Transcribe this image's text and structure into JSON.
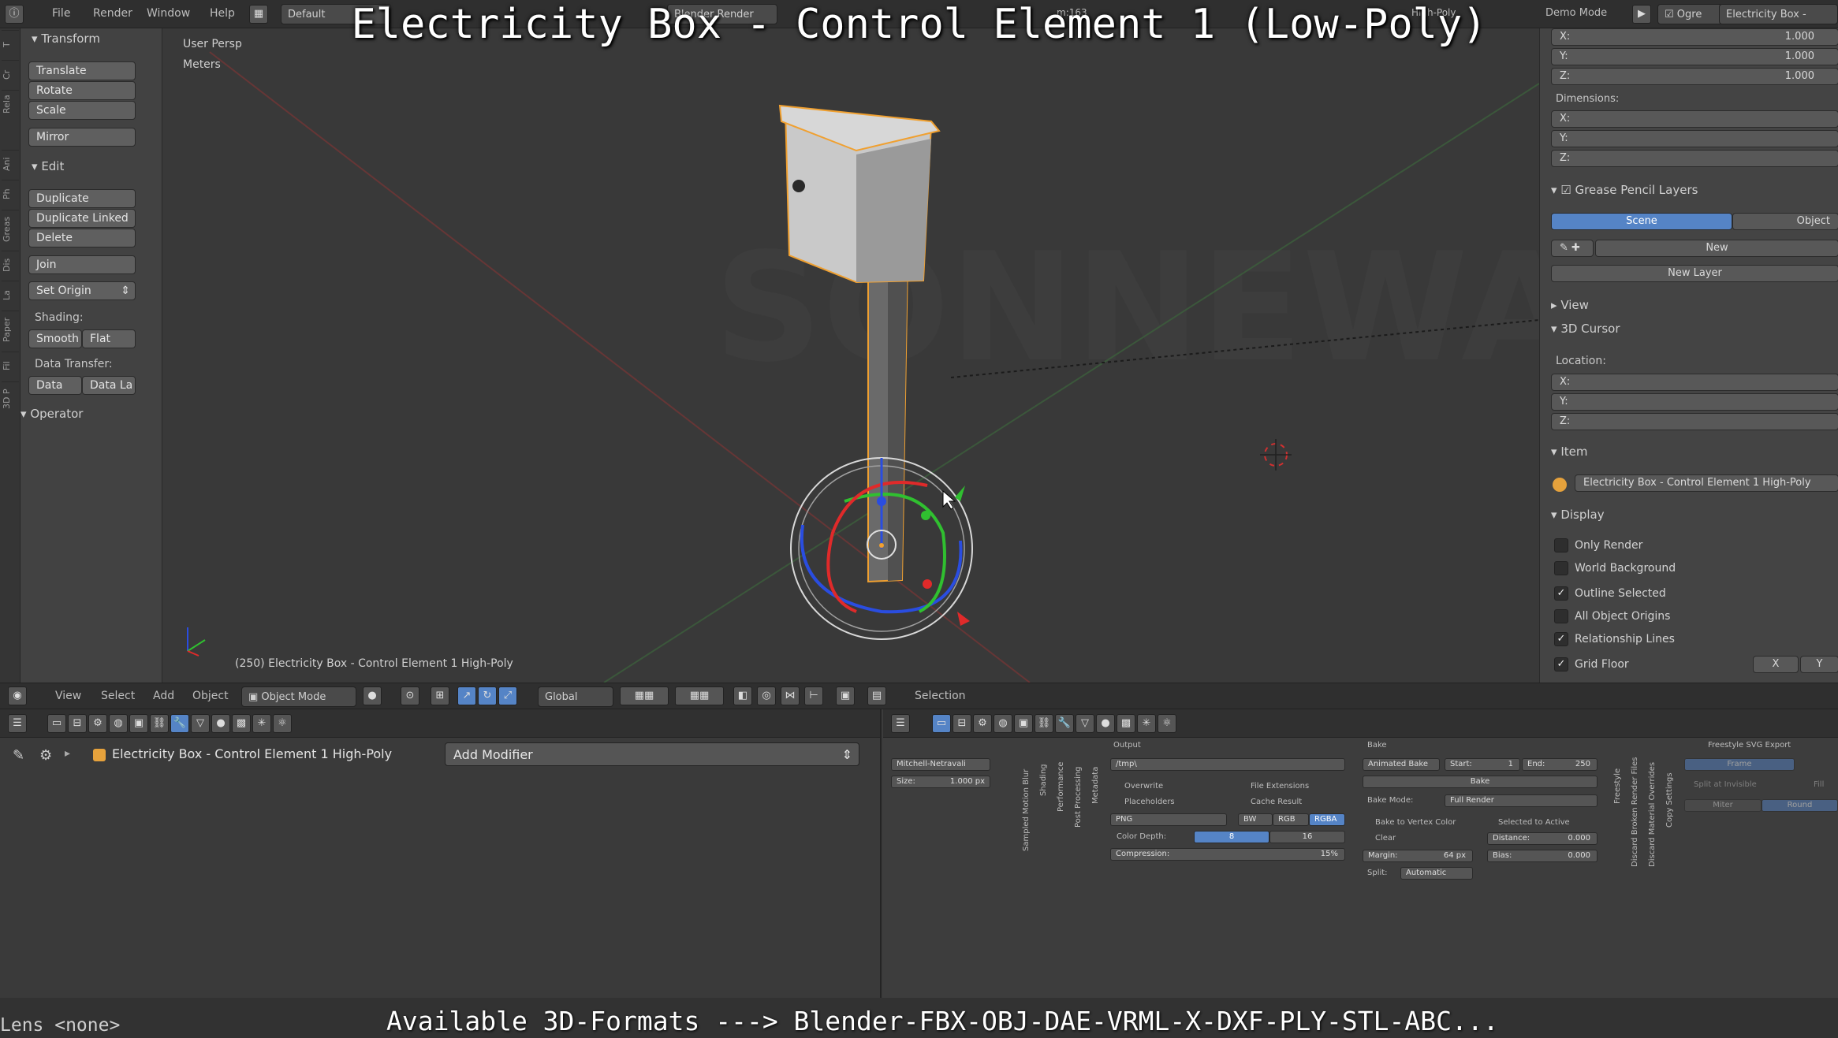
{
  "title_overlay": "Electricity Box - Control Element 1 (Low-Poly)",
  "topbar": {
    "menus": [
      "File",
      "Render",
      "Window",
      "Help"
    ],
    "layout": "Default",
    "engine": "Blender Render",
    "demo_mode": "Demo Mode",
    "ogre": "Ogre",
    "scene_name": "Electricity Box -",
    "stats_fragment": "m:163",
    "object_fragment": "Electricity Box -",
    "poly_fragment": "High-Poly"
  },
  "side_tabs": [
    "T",
    "Cr",
    "Rela",
    "Ani",
    "Ph",
    "Greas",
    "Dis",
    "La",
    "Paper",
    "Fil",
    "3D P"
  ],
  "toolshelf": {
    "transform_header": "Transform",
    "translate": "Translate",
    "rotate": "Rotate",
    "scale": "Scale",
    "mirror": "Mirror",
    "edit_header": "Edit",
    "duplicate": "Duplicate",
    "duplicate_linked": "Duplicate Linked",
    "delete": "Delete",
    "join": "Join",
    "set_origin": "Set Origin",
    "shading_label": "Shading:",
    "smooth": "Smooth",
    "flat": "Flat",
    "data_transfer_label": "Data Transfer:",
    "data": "Data",
    "data_la": "Data La",
    "operator_header": "Operator"
  },
  "viewport": {
    "view_name": "User Persp",
    "units": "Meters",
    "status": "(250) Electricity Box - Control Element 1 High-Poly",
    "watermark": "SONNEWARE"
  },
  "npanel": {
    "scale_x_label": "X:",
    "scale_x": "1.000",
    "scale_y_label": "Y:",
    "scale_y": "1.000",
    "scale_z_label": "Z:",
    "scale_z": "1.000",
    "dimensions_label": "Dimensions:",
    "dim_x": "X:",
    "dim_y": "Y:",
    "dim_z": "Z:",
    "grease_header": "Grease Pencil Layers",
    "tab_scene": "Scene",
    "tab_object": "Object",
    "new_btn": "New",
    "new_layer_btn": "New Layer",
    "view_header": "View",
    "cursor_header": "3D Cursor",
    "location_label": "Location:",
    "loc_x": "X:",
    "loc_y": "Y:",
    "loc_z": "Z:",
    "item_header": "Item",
    "item_name": "Electricity Box - Control Element 1 High-Poly",
    "display_header": "Display",
    "only_render": "Only Render",
    "world_background": "World Background",
    "outline_selected": "Outline Selected",
    "all_object_origins": "All Object Origins",
    "relationship_lines": "Relationship Lines",
    "grid_floor": "Grid Floor",
    "axis_x": "X",
    "axis_y": "Y"
  },
  "vp_header": {
    "menu_view": "View",
    "menu_select": "Select",
    "menu_add": "Add",
    "menu_object": "Object",
    "mode": "Object Mode",
    "orientation": "Global",
    "selection": "Selection"
  },
  "modifier_panel": {
    "object_name": "Electricity Box - Control Element 1 High-Poly",
    "add_modifier": "Add Modifier"
  },
  "render_panel": {
    "filter": "Mitchell-Netravali",
    "size_label": "Size:",
    "size_value": "1.000 px",
    "vert_labels": [
      "Sampled Motion Blur",
      "Shading",
      "Performance",
      "Post Processing",
      "Metadata"
    ],
    "output_header": "Output",
    "output_path": "/tmp\\",
    "overwrite": "Overwrite",
    "file_extensions": "File Extensions",
    "placeholders": "Placeholders",
    "cache_result": "Cache Result",
    "format": "PNG",
    "bw": "BW",
    "rgb": "RGB",
    "rgba": "RGBA",
    "color_depth_label": "Color Depth:",
    "depth_8": "8",
    "depth_16": "16",
    "compression_label": "Compression:",
    "compression_value": "15%",
    "bake_header": "Bake",
    "animated_bake": "Animated Bake",
    "start_label": "Start:",
    "start_value": "1",
    "end_label": "End:",
    "end_value": "250",
    "bake_btn": "Bake",
    "bake_mode_label": "Bake Mode:",
    "bake_mode": "Full Render",
    "bake_vertex_color": "Bake to Vertex Color",
    "selected_to_active": "Selected to Active",
    "clear": "Clear",
    "distance_label": "Distance:",
    "distance_value": "0.000",
    "margin_label": "Margin:",
    "margin_value": "64 px",
    "bias_label": "Bias:",
    "bias_value": "0.000",
    "split_label": "Split:",
    "split_value": "Automatic",
    "right_vert_labels": [
      "Freestyle",
      "Discard Broken Render Files",
      "Discard Material Overrides",
      "Copy Settings"
    ],
    "svg_header": "Freestyle SVG Export",
    "svg_frame": "Frame",
    "split_invisible": "Split at Invisible",
    "fill": "Fill",
    "miter": "Miter",
    "round": "Round"
  },
  "footer": {
    "lens": "Lens <none>",
    "formats": "Available 3D-Formats ---> Blender-FBX-OBJ-DAE-VRML-X-DXF-PLY-STL-ABC..."
  },
  "colors": {
    "selection_outline": "#f0a030",
    "axis_red": "#e02a2a",
    "axis_green": "#30c030",
    "axis_blue": "#2a4de0",
    "active_blue": "#5584c6"
  }
}
